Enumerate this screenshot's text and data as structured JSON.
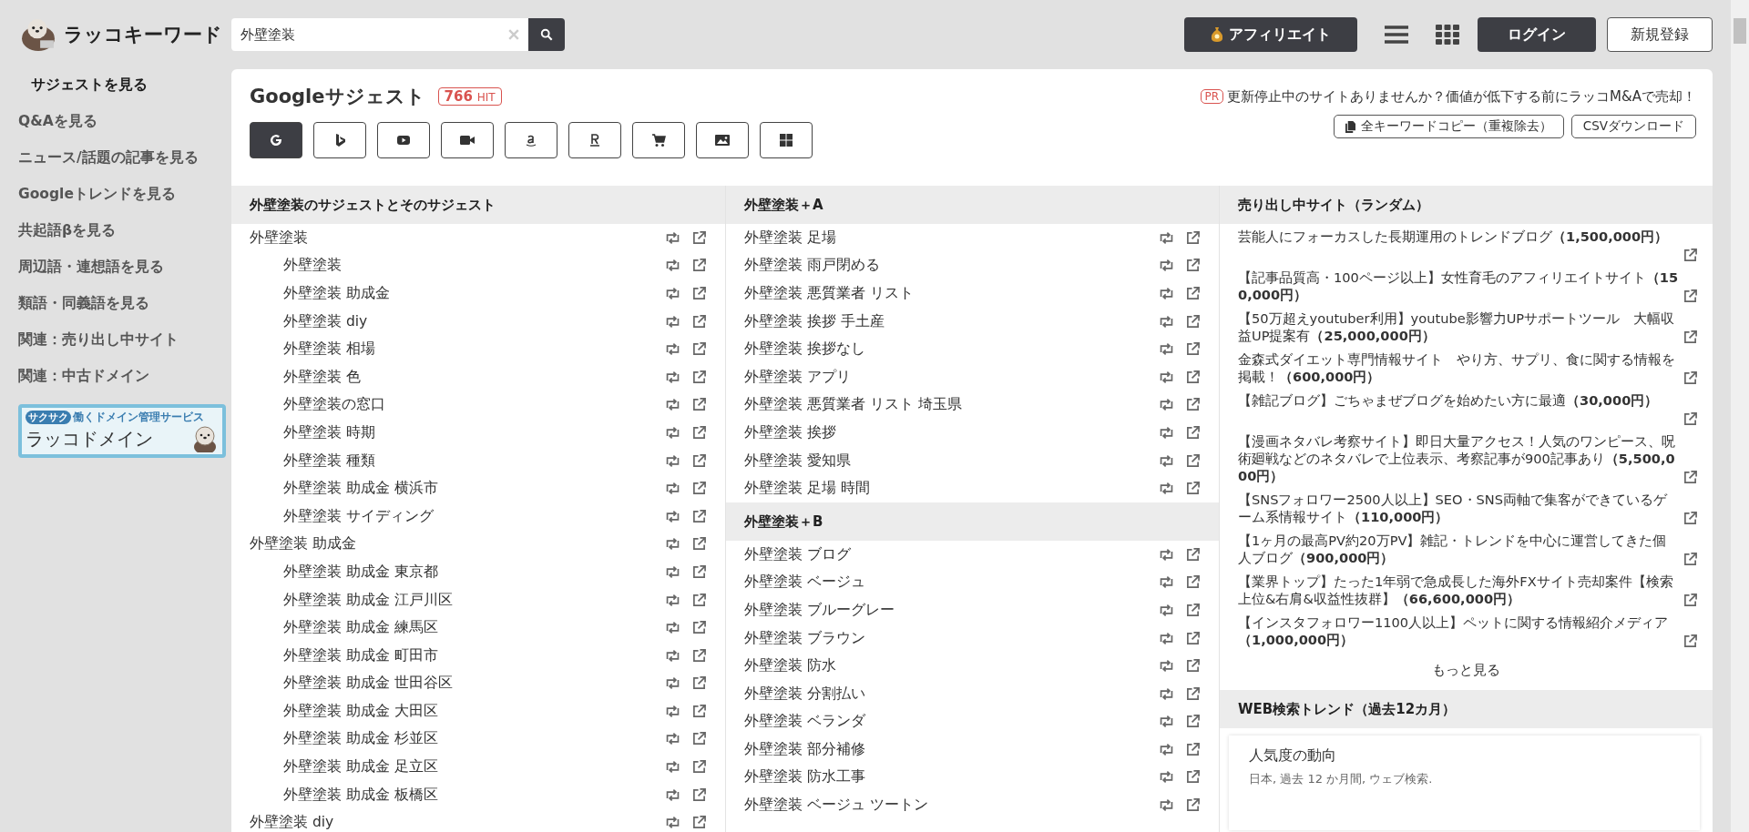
{
  "header": {
    "logo_text": "ラッコキーワード",
    "search": {
      "value": "外壁塗装"
    },
    "affiliate_button": "アフィリエイト",
    "login_button": "ログイン",
    "register_button": "新規登録"
  },
  "sidebar": {
    "items": [
      {
        "label": "サジェストを見る",
        "selected": true
      },
      {
        "label": "Q&Aを見る",
        "selected": false
      },
      {
        "label": "ニュース/話題の記事を見る",
        "selected": false
      },
      {
        "label": "Googleトレンドを見る",
        "selected": false
      },
      {
        "label": "共起語βを見る",
        "selected": false
      },
      {
        "label": "周辺語・連想語を見る",
        "selected": false
      },
      {
        "label": "類語・同義語を見る",
        "selected": false
      },
      {
        "label": "関連：売り出し中サイト",
        "selected": false
      },
      {
        "label": "関連：中古ドメイン",
        "selected": false
      }
    ],
    "banner": {
      "tagline": "サクサク",
      "subtitle": "働くドメイン管理サービス",
      "title": "ラッコドメイン"
    }
  },
  "panel": {
    "title": "Googleサジェスト",
    "hit_count": "766",
    "hit_unit": "HIT",
    "pr_badge": "PR",
    "pr_text": "更新停止中のサイトありませんか？価値が低下する前にラッコM&Aで売却！",
    "copy_button": "全キーワードコピー（重複除去）",
    "csv_button": "CSVダウンロード",
    "sources": [
      {
        "kind": "google",
        "selected": true
      },
      {
        "kind": "bing",
        "selected": false
      },
      {
        "kind": "youtube",
        "selected": false
      },
      {
        "kind": "video",
        "selected": false
      },
      {
        "kind": "amazon",
        "selected": false
      },
      {
        "kind": "rakuten",
        "selected": false
      },
      {
        "kind": "shopping",
        "selected": false
      },
      {
        "kind": "image",
        "selected": false
      },
      {
        "kind": "windows",
        "selected": false
      }
    ]
  },
  "suggest_column": {
    "heading": "外壁塗装のサジェストとそのサジェスト",
    "items": [
      {
        "text": "外壁塗装",
        "children": [
          {
            "text": "外壁塗装"
          },
          {
            "text": "外壁塗装 助成金"
          },
          {
            "text": "外壁塗装 diy"
          },
          {
            "text": "外壁塗装 相場"
          },
          {
            "text": "外壁塗装 色"
          },
          {
            "text": "外壁塗装の窓口"
          },
          {
            "text": "外壁塗装 時期"
          },
          {
            "text": "外壁塗装 種類"
          },
          {
            "text": "外壁塗装 助成金 横浜市"
          },
          {
            "text": "外壁塗装 サイディング"
          }
        ]
      },
      {
        "text": "外壁塗装 助成金",
        "children": [
          {
            "text": "外壁塗装 助成金 東京都"
          },
          {
            "text": "外壁塗装 助成金 江戸川区"
          },
          {
            "text": "外壁塗装 助成金 練馬区"
          },
          {
            "text": "外壁塗装 助成金 町田市"
          },
          {
            "text": "外壁塗装 助成金 世田谷区"
          },
          {
            "text": "外壁塗装 助成金 大田区"
          },
          {
            "text": "外壁塗装 助成金 杉並区"
          },
          {
            "text": "外壁塗装 助成金 足立区"
          },
          {
            "text": "外壁塗装 助成金 板橋区"
          }
        ]
      },
      {
        "text": "外壁塗装 diy"
      }
    ]
  },
  "alpha_column": {
    "sections": [
      {
        "heading": "外壁塗装＋A",
        "items": [
          "外壁塗装 足場",
          "外壁塗装 雨戸閉める",
          "外壁塗装 悪質業者 リスト",
          "外壁塗装 挨拶 手土産",
          "外壁塗装 挨拶なし",
          "外壁塗装 アプリ",
          "外壁塗装 悪質業者 リスト 埼玉県",
          "外壁塗装 挨拶",
          "外壁塗装 愛知県",
          "外壁塗装 足場 時間"
        ]
      },
      {
        "heading": "外壁塗装＋B",
        "items": [
          "外壁塗装 ブログ",
          "外壁塗装 ベージュ",
          "外壁塗装 ブルーグレー",
          "外壁塗装 ブラウン",
          "外壁塗装 防水",
          "外壁塗装 分割払い",
          "外壁塗装 ベランダ",
          "外壁塗装 部分補修",
          "外壁塗装 防水工事",
          "外壁塗装 ベージュ ツートン"
        ]
      }
    ]
  },
  "sale_sites": {
    "heading": "売り出し中サイト（ランダム）",
    "items": [
      "芸能人にフォーカスした長期運用のトレンドブログ**（1,500,000円）**",
      "【記事品質高・100ページ以上】女性育毛のアフィリエイトサイト**（150,000円）**",
      "【50万超えyoutuber利用】youtube影響力UPサポートツール　大幅収益UP提案有**（25,000,000円）**",
      "金森式ダイエット専門情報サイト　やり方、サプリ、食に関する情報を掲載！**（600,000円）**",
      "【雑記ブログ】ごちゃまぜブログを始めたい方に最適**（30,000円）**",
      "【漫画ネタバレ考察サイト】即日大量アクセス！人気のワンピース、呪術廻戦などのネタバレで上位表示、考察記事が900記事あり**（5,500,000円）**",
      "【SNSフォロワー2500人以上】SEO・SNS両軸で集客ができているゲーム系情報サイト**（110,000円）**",
      "【1ヶ月の最高PV約20万PV】雑記・トレンドを中心に運営してきた個人ブログ**（900,000円）**",
      "【業界トップ】たった1年弱で急成長した海外FXサイト売却案件【検索上位&右肩&収益性抜群】**（66,600,000円）**",
      "【インスタフォロワー1100人以上】ペットに関する情報紹介メディア**（1,000,000円）**"
    ],
    "more_link": "もっと見る"
  },
  "trend": {
    "heading": "WEB検索トレンド（過去12カ月）",
    "card_title": "人気度の動向",
    "card_subtitle": "日本, 過去 12 か月間, ウェブ検索."
  }
}
